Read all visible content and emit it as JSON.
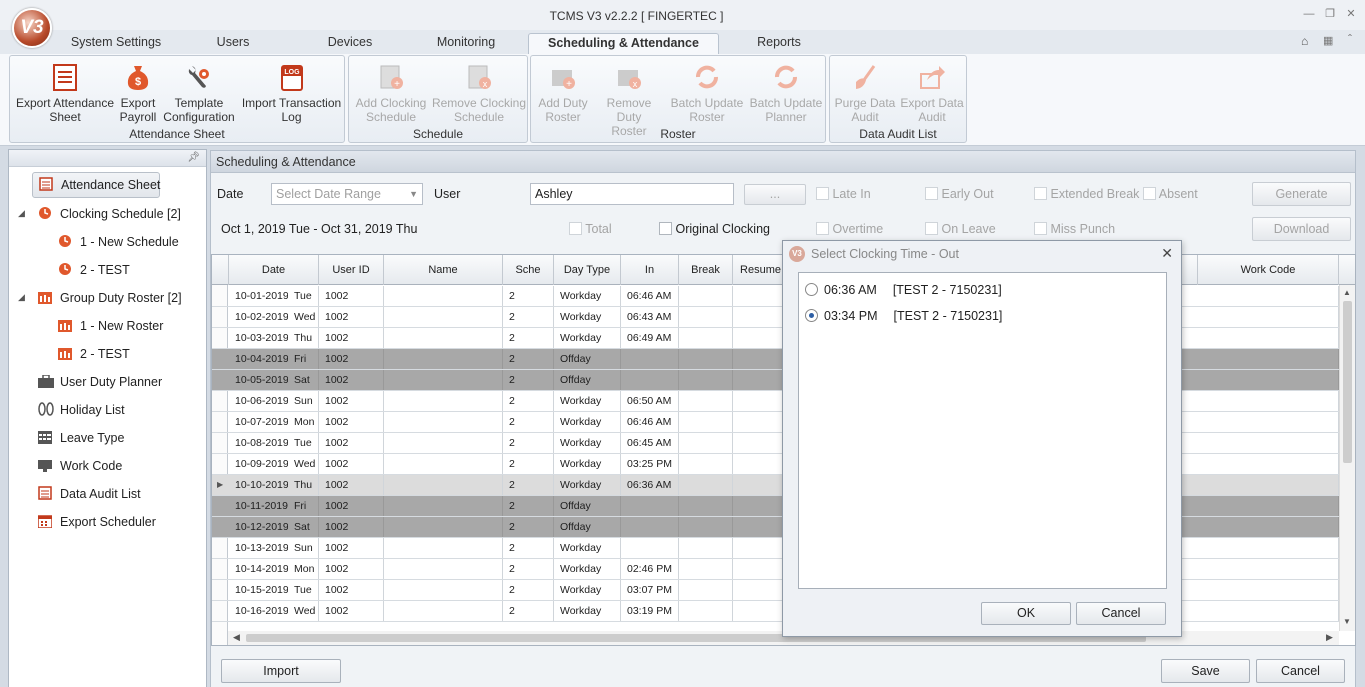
{
  "window": {
    "title": "TCMS V3 v2.2.2 [ FINGERTEC ]",
    "logo_text": "V3"
  },
  "ribbon_tabs": [
    "System Settings",
    "Users",
    "Devices",
    "Monitoring",
    "Scheduling & Attendance",
    "Reports"
  ],
  "active_tab": "Scheduling & Attendance",
  "ribbon_groups": [
    {
      "title": "Attendance Sheet",
      "buttons": [
        {
          "l1": "Export Attendance",
          "l2": "Sheet",
          "icon": "sheet-icon",
          "enabled": true
        },
        {
          "l1": "Export",
          "l2": "Payroll",
          "icon": "money-bag-icon",
          "enabled": true
        },
        {
          "l1": "Template",
          "l2": "Configuration",
          "icon": "tools-gear-icon",
          "enabled": true
        },
        {
          "l1": "Import Transaction",
          "l2": "Log",
          "icon": "log-icon",
          "enabled": true
        }
      ]
    },
    {
      "title": "Schedule",
      "buttons": [
        {
          "l1": "Add Clocking",
          "l2": "Schedule",
          "icon": "add-schedule-icon",
          "enabled": false
        },
        {
          "l1": "Remove Clocking",
          "l2": "Schedule",
          "icon": "remove-schedule-icon",
          "enabled": false
        }
      ]
    },
    {
      "title": "Roster",
      "buttons": [
        {
          "l1": "Add Duty",
          "l2": "Roster",
          "icon": "add-roster-icon",
          "enabled": false
        },
        {
          "l1": "Remove Duty",
          "l2": "Roster",
          "icon": "remove-roster-icon",
          "enabled": false
        },
        {
          "l1": "Batch Update",
          "l2": "Roster",
          "icon": "refresh-icon",
          "enabled": false
        },
        {
          "l1": "Batch Update",
          "l2": "Planner",
          "icon": "refresh-icon",
          "enabled": false
        }
      ]
    },
    {
      "title": "Data Audit List",
      "buttons": [
        {
          "l1": "Purge Data",
          "l2": "Audit",
          "icon": "broom-icon",
          "enabled": false
        },
        {
          "l1": "Export Data",
          "l2": "Audit",
          "icon": "export-arrow-icon",
          "enabled": false
        }
      ]
    }
  ],
  "sidebar": {
    "items": [
      {
        "label": "Attendance Sheet",
        "icon": "sheet-icon",
        "level": 0,
        "selected": true
      },
      {
        "label": "Clocking Schedule [2]",
        "icon": "clock-icon",
        "level": 0,
        "expanded": true
      },
      {
        "label": "1 - New Schedule",
        "icon": "clock-icon",
        "level": 1
      },
      {
        "label": "2 - TEST",
        "icon": "clock-icon",
        "level": 1
      },
      {
        "label": "Group Duty Roster [2]",
        "icon": "roster-icon",
        "level": 0,
        "expanded": true
      },
      {
        "label": "1 - New Roster",
        "icon": "roster-icon",
        "level": 1
      },
      {
        "label": "2 - TEST",
        "icon": "roster-icon",
        "level": 1
      },
      {
        "label": "User Duty Planner",
        "icon": "briefcase-icon",
        "level": 0
      },
      {
        "label": "Holiday List",
        "icon": "sandals-icon",
        "level": 0
      },
      {
        "label": "Leave Type",
        "icon": "table-icon",
        "level": 0
      },
      {
        "label": "Work Code",
        "icon": "monitor-icon",
        "level": 0
      },
      {
        "label": "Data Audit List",
        "icon": "list-icon",
        "level": 0
      },
      {
        "label": "Export Scheduler",
        "icon": "calendar-icon",
        "level": 0
      }
    ]
  },
  "panel": {
    "title": "Scheduling & Attendance",
    "date_label": "Date",
    "date_placeholder": "Select Date Range",
    "user_label": "User",
    "user_value": "Ashley",
    "browse_label": "...",
    "range_text": "Oct 1, 2019 Tue - Oct 31, 2019 Thu",
    "checks_row1": [
      "Late In",
      "Early Out",
      "Extended Break",
      "Absent"
    ],
    "checks_row2": [
      "Overtime",
      "On Leave",
      "Miss Punch"
    ],
    "total_label": "Total",
    "original_clocking_label": "Original Clocking",
    "generate_label": "Generate",
    "download_label": "Download",
    "import_label": "Import",
    "save_label": "Save",
    "cancel_label": "Cancel"
  },
  "grid": {
    "columns": [
      "Date",
      "User ID",
      "Name",
      "Sche",
      "Day Type",
      "In",
      "Break",
      "Resume",
      "Work Code"
    ],
    "rows": [
      {
        "date": "10-01-2019",
        "day": "Tue",
        "uid": "1002",
        "sche": "2",
        "daytype": "Workday",
        "in": "06:46 AM",
        "state": "normal"
      },
      {
        "date": "10-02-2019",
        "day": "Wed",
        "uid": "1002",
        "sche": "2",
        "daytype": "Workday",
        "in": "06:43 AM",
        "state": "normal"
      },
      {
        "date": "10-03-2019",
        "day": "Thu",
        "uid": "1002",
        "sche": "2",
        "daytype": "Workday",
        "in": "06:49 AM",
        "state": "normal"
      },
      {
        "date": "10-04-2019",
        "day": "Fri",
        "uid": "1002",
        "sche": "2",
        "daytype": "Offday",
        "in": "",
        "state": "off"
      },
      {
        "date": "10-05-2019",
        "day": "Sat",
        "uid": "1002",
        "sche": "2",
        "daytype": "Offday",
        "in": "",
        "state": "off"
      },
      {
        "date": "10-06-2019",
        "day": "Sun",
        "uid": "1002",
        "sche": "2",
        "daytype": "Workday",
        "in": "06:50 AM",
        "state": "normal"
      },
      {
        "date": "10-07-2019",
        "day": "Mon",
        "uid": "1002",
        "sche": "2",
        "daytype": "Workday",
        "in": "06:46 AM",
        "state": "normal"
      },
      {
        "date": "10-08-2019",
        "day": "Tue",
        "uid": "1002",
        "sche": "2",
        "daytype": "Workday",
        "in": "06:45 AM",
        "state": "normal"
      },
      {
        "date": "10-09-2019",
        "day": "Wed",
        "uid": "1002",
        "sche": "2",
        "daytype": "Workday",
        "in": "03:25 PM",
        "state": "normal"
      },
      {
        "date": "10-10-2019",
        "day": "Thu",
        "uid": "1002",
        "sche": "2",
        "daytype": "Workday",
        "in": "06:36 AM",
        "state": "selected"
      },
      {
        "date": "10-11-2019",
        "day": "Fri",
        "uid": "1002",
        "sche": "2",
        "daytype": "Offday",
        "in": "",
        "state": "off"
      },
      {
        "date": "10-12-2019",
        "day": "Sat",
        "uid": "1002",
        "sche": "2",
        "daytype": "Offday",
        "in": "",
        "state": "off"
      },
      {
        "date": "10-13-2019",
        "day": "Sun",
        "uid": "1002",
        "sche": "2",
        "daytype": "Workday",
        "in": "",
        "state": "normal"
      },
      {
        "date": "10-14-2019",
        "day": "Mon",
        "uid": "1002",
        "sche": "2",
        "daytype": "Workday",
        "in": "02:46 PM",
        "state": "normal"
      },
      {
        "date": "10-15-2019",
        "day": "Tue",
        "uid": "1002",
        "sche": "2",
        "daytype": "Workday",
        "in": "03:07 PM",
        "state": "normal"
      },
      {
        "date": "10-16-2019",
        "day": "Wed",
        "uid": "1002",
        "sche": "2",
        "daytype": "Workday",
        "in": "03:19 PM",
        "state": "normal"
      }
    ]
  },
  "dialog": {
    "title": "Select Clocking Time - Out",
    "options": [
      {
        "time": "06:36 AM",
        "info": "[TEST 2 - 7150231]",
        "selected": false
      },
      {
        "time": "03:34 PM",
        "info": "[TEST 2 - 7150231]",
        "selected": true
      }
    ],
    "ok_label": "OK",
    "cancel_label": "Cancel"
  }
}
